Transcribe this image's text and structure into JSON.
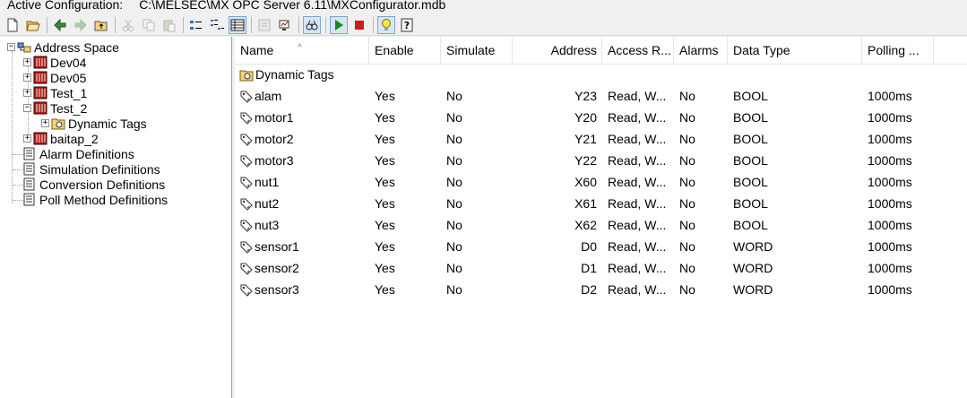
{
  "status": {
    "label": "Active Configuration:",
    "path": "C:\\MELSEC\\MX OPC Server 6.11\\MXConfigurator.mdb"
  },
  "toolbar": {
    "buttons": [
      "new-icon",
      "open-icon",
      "back-arrow-icon",
      "forward-arrow-icon",
      "up-folder-icon",
      "cut-icon",
      "copy-icon",
      "paste-icon",
      "small-icons-view-icon",
      "list-view-icon",
      "details-view-icon",
      "properties-icon",
      "monitor-icon",
      "connect-icon",
      "run-icon",
      "stop-icon",
      "hint-icon",
      "help-icon"
    ]
  },
  "tree": {
    "root": "Address Space",
    "devices": [
      "Dev04",
      "Dev05",
      "Test_1",
      "Test_2"
    ],
    "child": "Dynamic Tags",
    "device_last": "baitap_2",
    "definitions": [
      "Alarm Definitions",
      "Simulation Definitions",
      "Conversion Definitions",
      "Poll Method Definitions"
    ]
  },
  "list": {
    "columns": [
      "Name",
      "Enable",
      "Simulate",
      "Address",
      "Access R...",
      "Alarms",
      "Data Type",
      "Polling ..."
    ],
    "folder": "Dynamic Tags",
    "rows": [
      {
        "name": "alam",
        "enable": "Yes",
        "simulate": "No",
        "address": "Y23",
        "access": "Read, W...",
        "alarms": "No",
        "type": "BOOL",
        "polling": "1000ms"
      },
      {
        "name": "motor1",
        "enable": "Yes",
        "simulate": "No",
        "address": "Y20",
        "access": "Read, W...",
        "alarms": "No",
        "type": "BOOL",
        "polling": "1000ms"
      },
      {
        "name": "motor2",
        "enable": "Yes",
        "simulate": "No",
        "address": "Y21",
        "access": "Read, W...",
        "alarms": "No",
        "type": "BOOL",
        "polling": "1000ms"
      },
      {
        "name": "motor3",
        "enable": "Yes",
        "simulate": "No",
        "address": "Y22",
        "access": "Read, W...",
        "alarms": "No",
        "type": "BOOL",
        "polling": "1000ms"
      },
      {
        "name": "nut1",
        "enable": "Yes",
        "simulate": "No",
        "address": "X60",
        "access": "Read, W...",
        "alarms": "No",
        "type": "BOOL",
        "polling": "1000ms"
      },
      {
        "name": "nut2",
        "enable": "Yes",
        "simulate": "No",
        "address": "X61",
        "access": "Read, W...",
        "alarms": "No",
        "type": "BOOL",
        "polling": "1000ms"
      },
      {
        "name": "nut3",
        "enable": "Yes",
        "simulate": "No",
        "address": "X62",
        "access": "Read, W...",
        "alarms": "No",
        "type": "BOOL",
        "polling": "1000ms"
      },
      {
        "name": "sensor1",
        "enable": "Yes",
        "simulate": "No",
        "address": "D0",
        "access": "Read, W...",
        "alarms": "No",
        "type": "WORD",
        "polling": "1000ms"
      },
      {
        "name": "sensor2",
        "enable": "Yes",
        "simulate": "No",
        "address": "D1",
        "access": "Read, W...",
        "alarms": "No",
        "type": "WORD",
        "polling": "1000ms"
      },
      {
        "name": "sensor3",
        "enable": "Yes",
        "simulate": "No",
        "address": "D2",
        "access": "Read, W...",
        "alarms": "No",
        "type": "WORD",
        "polling": "1000ms"
      }
    ]
  }
}
